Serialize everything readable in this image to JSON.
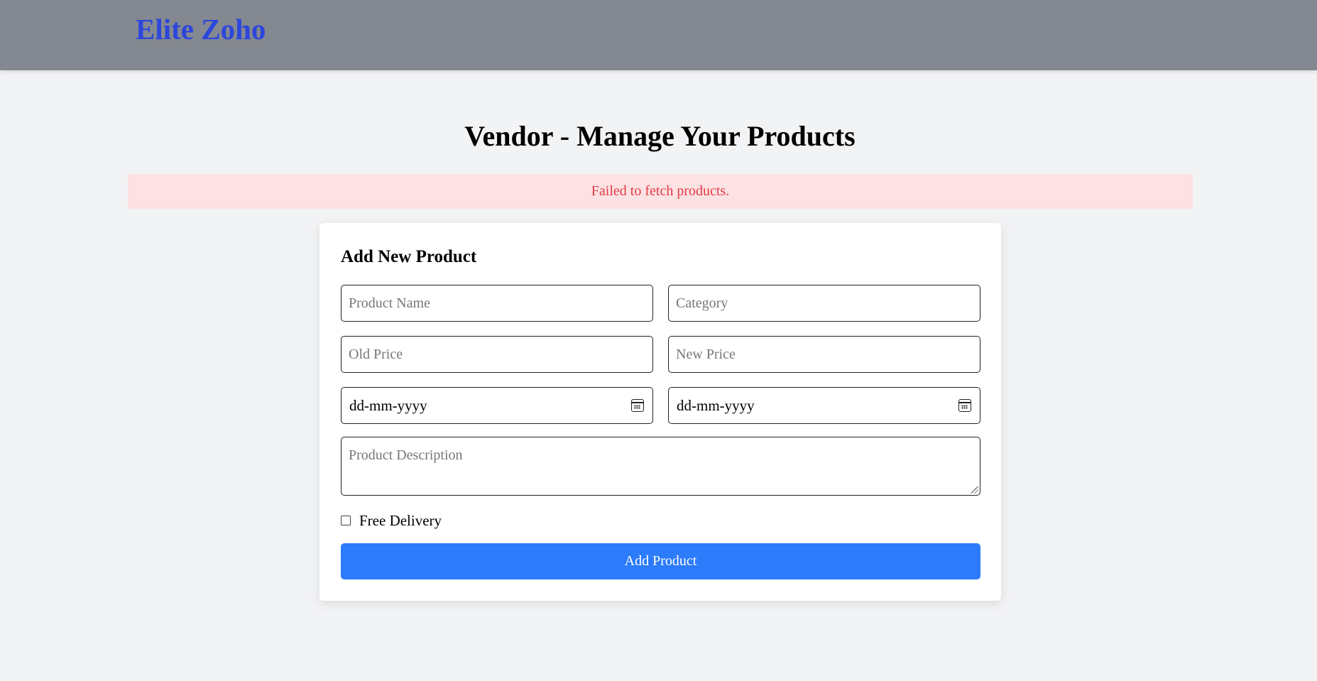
{
  "header": {
    "brand": "Elite Zoho"
  },
  "page": {
    "title": "Vendor - Manage Your Products",
    "error_message": "Failed to fetch products."
  },
  "form": {
    "title": "Add New Product",
    "fields": {
      "product_name": {
        "placeholder": "Product Name",
        "value": ""
      },
      "category": {
        "placeholder": "Category",
        "value": ""
      },
      "old_price": {
        "placeholder": "Old Price",
        "value": ""
      },
      "new_price": {
        "placeholder": "New Price",
        "value": ""
      },
      "start_date": {
        "display": "dd-mm-yyyy",
        "icon": "calendar-icon"
      },
      "end_date": {
        "display": "dd-mm-yyyy",
        "icon": "calendar-icon"
      },
      "description": {
        "placeholder": "Product Description",
        "value": ""
      }
    },
    "free_delivery": {
      "label": "Free Delivery",
      "checked": false
    },
    "submit_label": "Add Product"
  },
  "colors": {
    "navbar_bg": "#848891",
    "brand": "#2d46dc",
    "page_bg": "#f2f3f5",
    "error_bg": "#fde2e3",
    "error_text": "#e23b45",
    "primary_button": "#2b7bfa"
  }
}
